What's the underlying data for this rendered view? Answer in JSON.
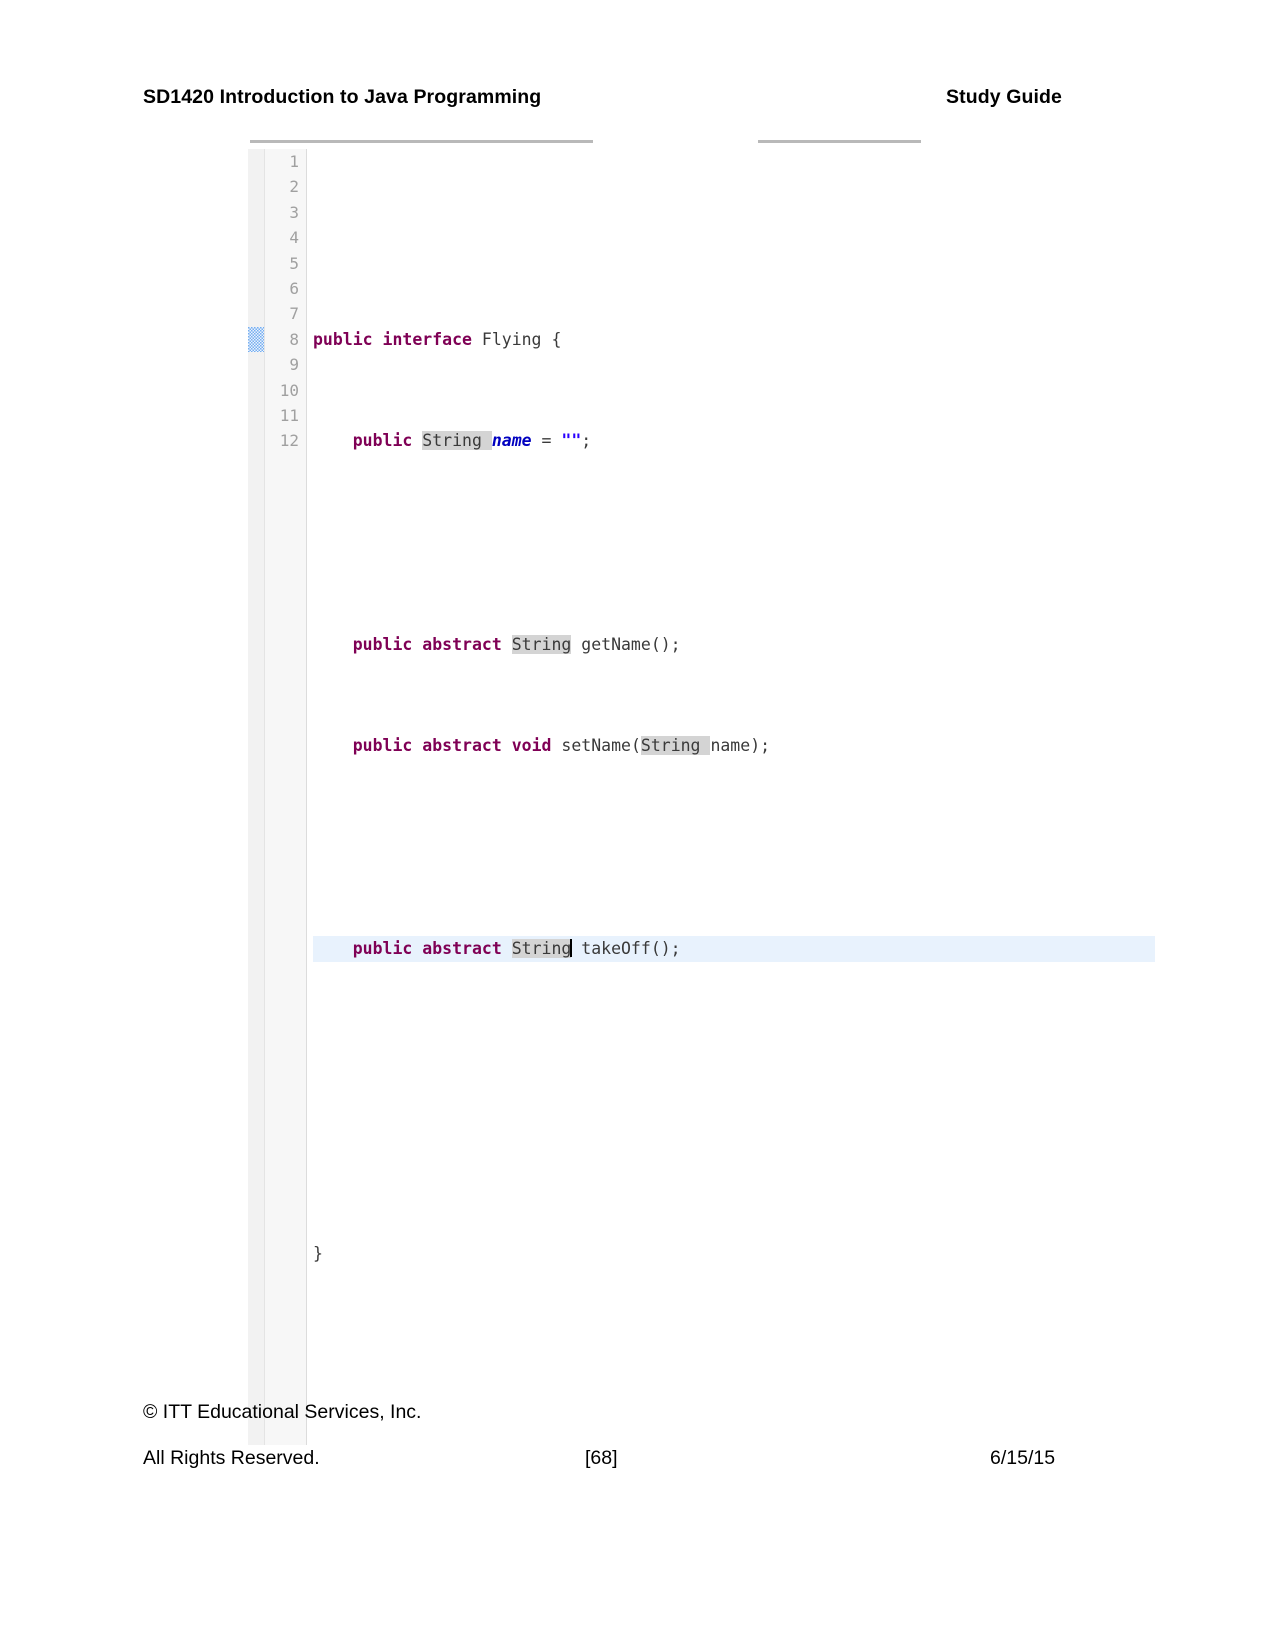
{
  "header": {
    "title": "SD1420 Introduction to Java Programming",
    "right_label": "Study Guide"
  },
  "figure": {
    "name": "java-code-editor-screenshot",
    "editor": {
      "current_line": 8,
      "breakpoint_marker_line": 8,
      "cursor_line": 8,
      "cursor_after_token": "String",
      "line_numbers": [
        "1",
        "2",
        "3",
        "4",
        "5",
        "6",
        "7",
        "8",
        "9",
        "10",
        "11",
        "12"
      ],
      "lines": [
        {
          "number": "1",
          "text": ""
        },
        {
          "number": "2",
          "text": "public interface Flying {"
        },
        {
          "number": "3",
          "text": "    public String name = \"\";"
        },
        {
          "number": "4",
          "text": ""
        },
        {
          "number": "5",
          "text": "    public abstract String getName();"
        },
        {
          "number": "6",
          "text": "    public abstract void setName(String name);"
        },
        {
          "number": "7",
          "text": ""
        },
        {
          "number": "8",
          "text": "    public abstract String takeOff();"
        },
        {
          "number": "9",
          "text": ""
        },
        {
          "number": "10",
          "text": ""
        },
        {
          "number": "11",
          "text": "}"
        },
        {
          "number": "12",
          "text": ""
        }
      ],
      "tokens": {
        "kw_public": "public",
        "kw_interface": "interface",
        "kw_abstract": "abstract",
        "kw_void": "void",
        "type_string": "String",
        "name_flying": "Flying",
        "field_name": "name",
        "empty_string_literal": "\"\"",
        "method_getName": "getName",
        "method_setName": "setName",
        "method_takeOff": "takeOff",
        "param_name": "name",
        "brace_open": "{",
        "brace_close": "}",
        "assign": "=",
        "semicolon": ";",
        "parens_empty": "();",
        "paren_open": "(",
        "paren_close_semi": ");"
      },
      "colors": {
        "keyword": "#7f0055",
        "string_literal": "#2a00ff",
        "field": "#0000c0",
        "plain": "#3a3a3a",
        "occurrence_highlight": "#d4d4d4",
        "current_line_highlight": "#e8f2fd",
        "gutter_background": "#f7f7f7",
        "gutter_text": "#a0a0a0",
        "marker_blue": "#76aef0",
        "rule_gray": "#b9b9b9"
      }
    }
  },
  "footer": {
    "copyright": "© ITT Educational Services, Inc.",
    "rights": "All Rights Reserved.",
    "page_number": "[68]",
    "date": "6/15/15"
  }
}
